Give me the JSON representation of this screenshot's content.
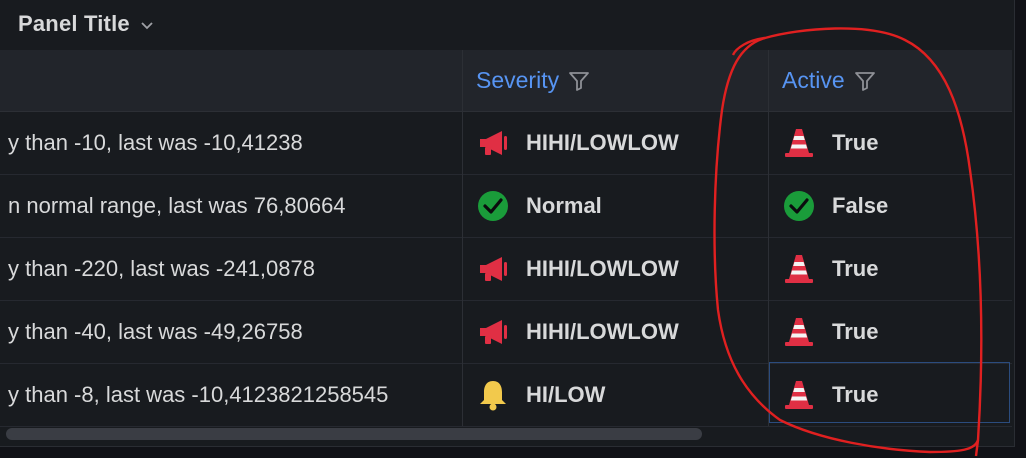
{
  "panel": {
    "title": "Panel Title"
  },
  "table": {
    "columns": [
      {
        "label": "Severity"
      },
      {
        "label": "Active"
      }
    ],
    "rows": [
      {
        "message": "y than -10, last was -10,41238",
        "severity": "HIHI/LOWLOW",
        "severity_icon": "megaphone-icon",
        "active": "True",
        "active_icon": "traffic-cone-icon"
      },
      {
        "message": "n normal range, last was 76,80664",
        "severity": "Normal",
        "severity_icon": "check-circle-icon",
        "active": "False",
        "active_icon": "check-circle-icon"
      },
      {
        "message": "y than -220, last was -241,0878",
        "severity": "HIHI/LOWLOW",
        "severity_icon": "megaphone-icon",
        "active": "True",
        "active_icon": "traffic-cone-icon"
      },
      {
        "message": "y than -40, last was -49,26758",
        "severity": "HIHI/LOWLOW",
        "severity_icon": "megaphone-icon",
        "active": "True",
        "active_icon": "traffic-cone-icon"
      },
      {
        "message": "y than -8, last was -10,4123821258545",
        "severity": "HI/LOW",
        "severity_icon": "bell-icon",
        "active": "True",
        "active_icon": "traffic-cone-icon"
      }
    ]
  },
  "colors": {
    "header_link": "#5794f2",
    "alert_red": "#e02f44",
    "ok_green": "#1a9c3a",
    "warn_yellow": "#f2c94c",
    "annotation_red": "#e02020"
  }
}
